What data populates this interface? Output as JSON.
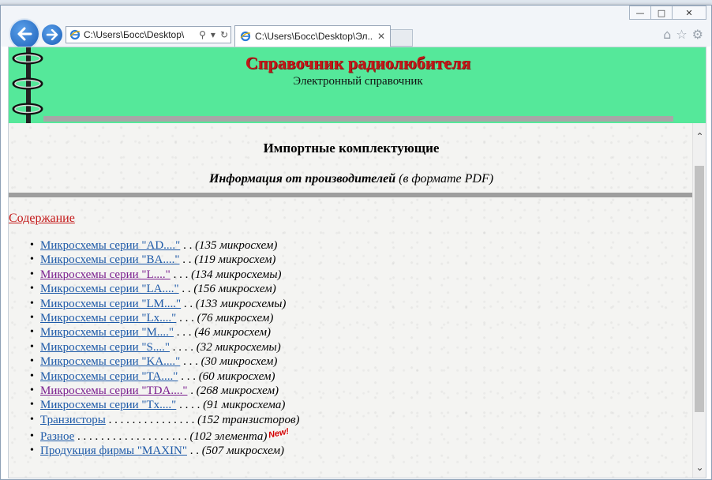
{
  "window": {
    "address_text": "C:\\Users\\Босс\\Desktop\\",
    "tab_title": "C:\\Users\\Босс\\Desktop\\Эл...",
    "tab_close": "✕",
    "minimize": "—",
    "maximize": "□",
    "close": "✕"
  },
  "banner": {
    "title": "Справочник радиолюбителя",
    "subtitle": "Электронный справочник"
  },
  "content": {
    "heading": "Импортные комплектующие",
    "info_bold": "Информация от производителей",
    "info_rest": " (в формате PDF)",
    "toc": "Содержание",
    "items": [
      {
        "link": "Микросхемы серии \"AD....\"",
        "dots": " . . ",
        "count": "(135 микросхем)",
        "visited": false
      },
      {
        "link": "Микросхемы серии \"BA....\"",
        "dots": " . . ",
        "count": "(119 микросхем)",
        "visited": false
      },
      {
        "link": "Микросхемы серии \"L....\"",
        "dots": " . . . ",
        "count": "(134 микросхемы)",
        "visited": true
      },
      {
        "link": "Микросхемы серии \"LA....\"",
        "dots": " . . ",
        "count": "(156 микросхем)",
        "visited": false
      },
      {
        "link": "Микросхемы серии \"LM....\"",
        "dots": " . . ",
        "count": "(133 микросхемы)",
        "visited": false
      },
      {
        "link": "Микросхемы серии \"Lx....\"",
        "dots": " . . . ",
        "count": "(76 микросхем)",
        "visited": false
      },
      {
        "link": "Микросхемы серии \"M....\"",
        "dots": " . . . ",
        "count": "(46 микросхем)",
        "visited": false
      },
      {
        "link": "Микросхемы серии \"S....\"",
        "dots": " . . . . ",
        "count": "(32 микросхемы)",
        "visited": false
      },
      {
        "link": "Микросхемы серии \"KA....\"",
        "dots": " . . . ",
        "count": "(30 микросхем)",
        "visited": false
      },
      {
        "link": "Микросхемы серии \"TA....\"",
        "dots": " . . . ",
        "count": "(60 микросхем)",
        "visited": false
      },
      {
        "link": "Микросхемы серии \"TDA....\"",
        "dots": " . ",
        "count": "(268 микросхем)",
        "visited": true
      },
      {
        "link": "Микросхемы серии \"Tx....\"",
        "dots": " . . . . ",
        "count": "(91 микросхема)",
        "visited": false
      },
      {
        "link": "Транзисторы",
        "dots": " . . . . . . . . . . . . . . . ",
        "count": "(152 транзисторов)",
        "visited": false
      },
      {
        "link": "Разное",
        "dots": " . . . . . . . . . . . . . . . . . . . ",
        "count": "(102 элемента)",
        "visited": false,
        "badge": "New!"
      },
      {
        "link": "Продукция фирмы \"MAXIN\"",
        "dots": " . . ",
        "count": "(507 микросхем)",
        "visited": false
      }
    ]
  },
  "colors": {
    "banner_bg": "#55e89a",
    "title_red": "#c41818",
    "link_blue": "#1e5aa8",
    "link_visited": "#7b1f8f"
  }
}
